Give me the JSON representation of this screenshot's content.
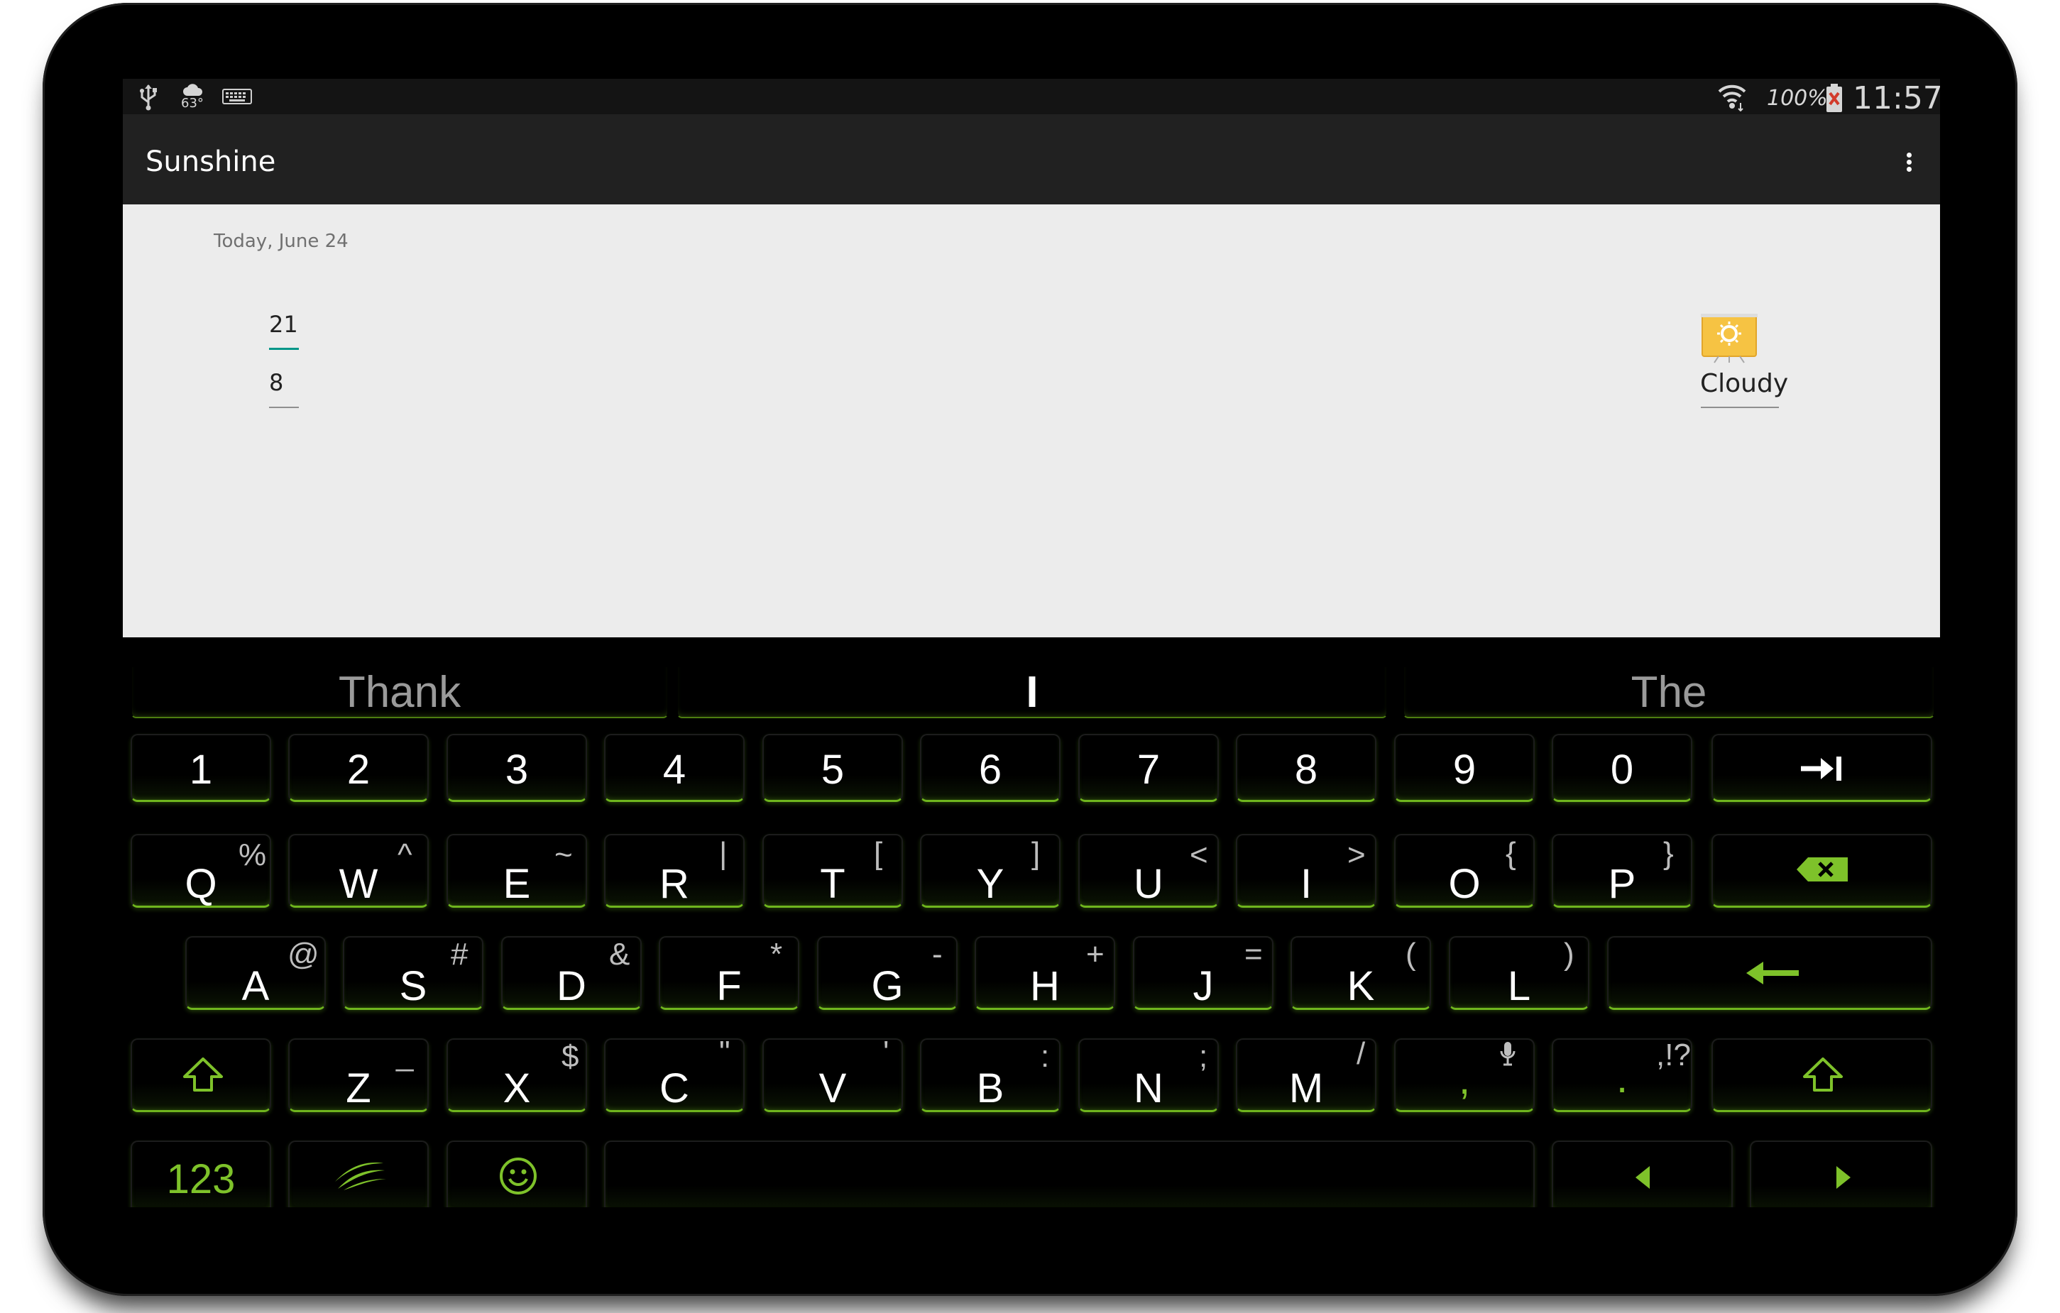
{
  "status_bar": {
    "weather_temp": "63°",
    "battery_percent": "100%",
    "time": "11:57",
    "icons": [
      "usb-icon",
      "weather-cloud-icon",
      "keyboard-icon",
      "wifi-icon",
      "battery-icon"
    ]
  },
  "app_bar": {
    "title": "Sunshine",
    "menu_icon": "overflow-menu-icon"
  },
  "forecast": {
    "date": "Today, June 24",
    "high": "21",
    "low": "8",
    "condition": "Cloudy",
    "icon": "weather-sun-icon",
    "accent_color": "#009688"
  },
  "keyboard": {
    "suggestions": [
      "Thank",
      "I",
      "The"
    ],
    "rows": {
      "numbers": [
        "1",
        "2",
        "3",
        "4",
        "5",
        "6",
        "7",
        "8",
        "9",
        "0"
      ],
      "top": [
        {
          "main": "Q",
          "alt": "%"
        },
        {
          "main": "W",
          "alt": "^"
        },
        {
          "main": "E",
          "alt": "~"
        },
        {
          "main": "R",
          "alt": "|"
        },
        {
          "main": "T",
          "alt": "["
        },
        {
          "main": "Y",
          "alt": "]"
        },
        {
          "main": "U",
          "alt": "<"
        },
        {
          "main": "I",
          "alt": ">"
        },
        {
          "main": "O",
          "alt": "{"
        },
        {
          "main": "P",
          "alt": "}"
        }
      ],
      "middle": [
        {
          "main": "A",
          "alt": "@"
        },
        {
          "main": "S",
          "alt": "#"
        },
        {
          "main": "D",
          "alt": "&"
        },
        {
          "main": "F",
          "alt": "*"
        },
        {
          "main": "G",
          "alt": "-"
        },
        {
          "main": "H",
          "alt": "+"
        },
        {
          "main": "J",
          "alt": "="
        },
        {
          "main": "K",
          "alt": "("
        },
        {
          "main": "L",
          "alt": ")"
        }
      ],
      "bottom": [
        {
          "main": "Z",
          "alt": "_"
        },
        {
          "main": "X",
          "alt": "$"
        },
        {
          "main": "C",
          "alt": "\""
        },
        {
          "main": "V",
          "alt": "'"
        },
        {
          "main": "B",
          "alt": ":"
        },
        {
          "main": "N",
          "alt": ";"
        },
        {
          "main": "M",
          "alt": "/"
        },
        {
          "main": ",",
          "alt": ""
        },
        {
          "main": ".",
          "alt": ",!?"
        }
      ],
      "function": {
        "numbers_key": "123"
      }
    },
    "accent_color": "#7ec22a"
  }
}
